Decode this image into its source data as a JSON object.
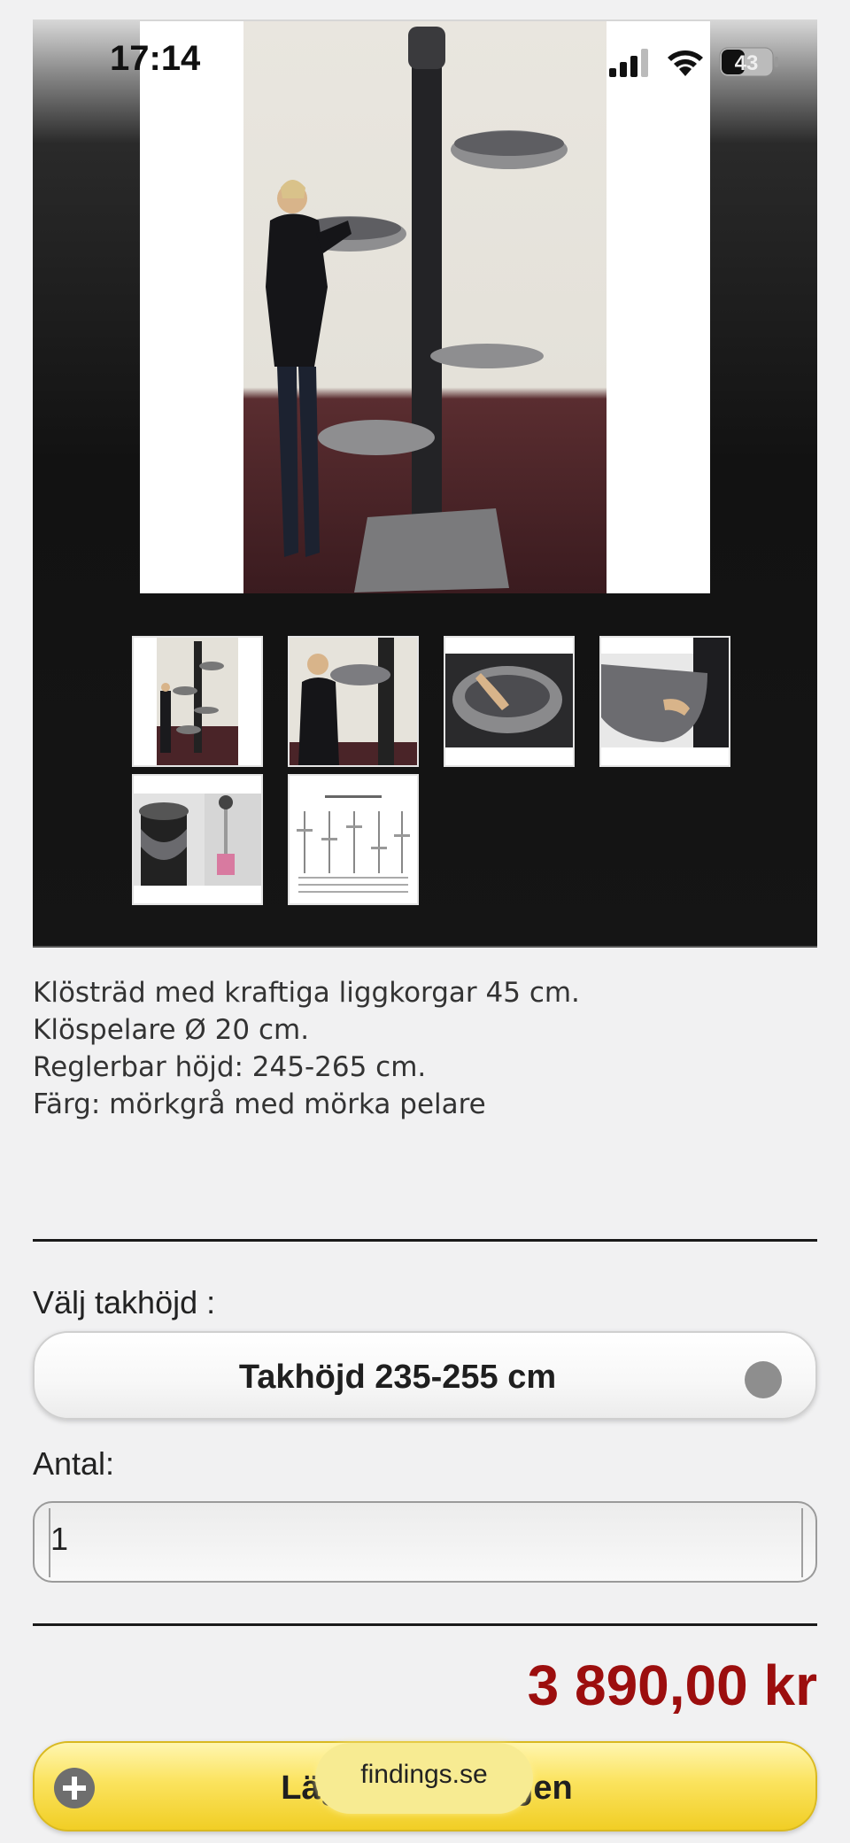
{
  "status_bar": {
    "time": "17:14",
    "battery_level": "43",
    "icons": [
      "signal-icon",
      "wifi-icon",
      "battery-icon"
    ]
  },
  "gallery": {
    "main_image": "cat-tree-with-woman-photo",
    "thumbnails": [
      "thumbnail-full-tree",
      "thumbnail-woman-and-tree",
      "thumbnail-basket-hand",
      "thumbnail-basket-side",
      "thumbnail-pillar-top",
      "thumbnail-dimension-drawing"
    ]
  },
  "description": {
    "lines": [
      "Klösträd med kraftiga liggkorgar 45 cm.",
      "Klöspelare Ø 20 cm.",
      "Reglerbar höjd: 245-265 cm.",
      "Färg: mörkgrå med mörka pelare"
    ]
  },
  "options": {
    "ceiling_label": "Välj takhöjd :",
    "ceiling_value": "Takhöjd 235-255 cm",
    "quantity_label": "Antal:",
    "quantity_value": "1"
  },
  "price": "3 890,00 kr",
  "cart_button": {
    "label": "Lägg i varukorgen"
  },
  "url_pill": "findings.se",
  "colors": {
    "price": "#9c0e0e",
    "cart_button": "#fbe35e",
    "gallery_bg": "#121212"
  }
}
